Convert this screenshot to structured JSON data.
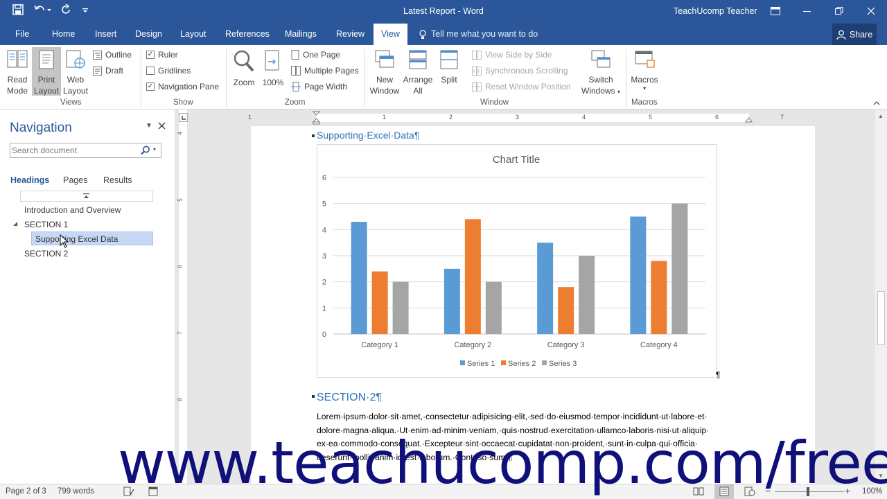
{
  "window": {
    "title": "Latest Report - Word",
    "user": "TeachUcomp Teacher"
  },
  "tabs": [
    "File",
    "Home",
    "Insert",
    "Design",
    "Layout",
    "References",
    "Mailings",
    "Review",
    "View"
  ],
  "active_tab": "View",
  "tell_me": "Tell me what you want to do",
  "share": "Share",
  "ribbon": {
    "views": {
      "label": "Views",
      "read_mode": [
        "Read",
        "Mode"
      ],
      "print_layout": [
        "Print",
        "Layout"
      ],
      "web_layout": [
        "Web",
        "Layout"
      ],
      "outline": "Outline",
      "draft": "Draft"
    },
    "show": {
      "label": "Show",
      "ruler": "Ruler",
      "gridlines": "Gridlines",
      "navigation_pane": "Navigation Pane"
    },
    "zoom": {
      "label": "Zoom",
      "zoom": "Zoom",
      "hundred": "100%",
      "one_page": "One Page",
      "multiple_pages": "Multiple Pages",
      "page_width": "Page Width"
    },
    "window": {
      "label": "Window",
      "new_window": [
        "New",
        "Window"
      ],
      "arrange_all": [
        "Arrange",
        "All"
      ],
      "split": "Split",
      "side_by_side": "View Side by Side",
      "sync_scrolling": "Synchronous Scrolling",
      "reset_position": "Reset Window Position",
      "switch_windows": [
        "Switch",
        "Windows"
      ]
    },
    "macros": {
      "label": "Macros",
      "macros": "Macros"
    }
  },
  "nav": {
    "title": "Navigation",
    "search_placeholder": "Search document",
    "tabs": [
      "Headings",
      "Pages",
      "Results"
    ],
    "items": [
      "Introduction and Overview",
      "SECTION 1",
      "Supporting Excel Data",
      "SECTION 2"
    ]
  },
  "document": {
    "heading1": "Supporting·Excel·Data¶",
    "heading2": "SECTION·2¶",
    "pilcrow": "¶",
    "lorem": "Lorem·ipsum·dolor·sit·amet,·consectetur·adipisicing·elit,·sed·do·eiusmod·tempor·incididunt·ut·labore·et· dolore·magna·aliqua.·Ut·enim·ad·minim·veniam,·quis·nostrud·exercitation·ullamco·laboris·nisi·ut·aliquip· ex·ea·commodo·consequat.·Excepteur·sint·occaecat·cupidatat·non·proident,·sunt·in·culpa·qui·officia· deserunt·mollit·anim·id·est·laborum.·Contoso·sum.¶"
  },
  "chart_data": {
    "type": "bar",
    "title": "Chart Title",
    "categories": [
      "Category 1",
      "Category 2",
      "Category 3",
      "Category 4"
    ],
    "series": [
      {
        "name": "Series 1",
        "values": [
          4.3,
          2.5,
          3.5,
          4.5
        ],
        "color": "#5b9bd5"
      },
      {
        "name": "Series 2",
        "values": [
          2.4,
          4.4,
          1.8,
          2.8
        ],
        "color": "#ed7d31"
      },
      {
        "name": "Series 3",
        "values": [
          2,
          2,
          3,
          5
        ],
        "color": "#a5a5a5"
      }
    ],
    "ylim": [
      0,
      6
    ],
    "yticks": [
      "0",
      "1",
      "2",
      "3",
      "4",
      "5",
      "6"
    ],
    "grid": true,
    "legend": "bottom"
  },
  "ruler_numbers": [
    "1",
    "1",
    "2",
    "3",
    "4",
    "5",
    "6",
    "7"
  ],
  "vruler_numbers": [
    "4",
    "5",
    "6",
    "7",
    "8"
  ],
  "status": {
    "page": "Page 2 of 3",
    "words": "799 words",
    "zoom": "100%"
  },
  "watermark": "www.teachucomp.com/free"
}
